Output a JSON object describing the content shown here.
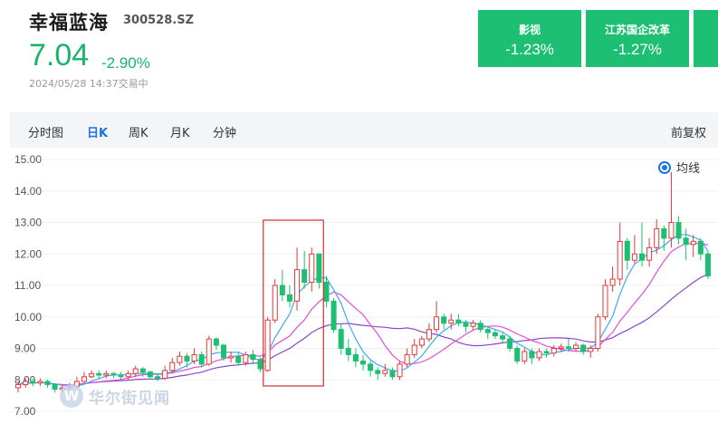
{
  "header": {
    "name": "幸福蓝海",
    "code": "300528.SZ",
    "price": "7.04",
    "change": "-2.90%",
    "timestamp": "2024/05/28 14:37交易中"
  },
  "sectors": [
    {
      "name": "影视",
      "change": "-1.23%"
    },
    {
      "name": "江苏国企改革",
      "change": "-1.27%"
    }
  ],
  "tabs": [
    "分时图",
    "日K",
    "周K",
    "月K",
    "分钟"
  ],
  "active_tab": "日K",
  "adjust_label": "前复权",
  "legend_label": "均线",
  "watermark": {
    "logo": "W",
    "text": "华尔街见闻"
  },
  "colors": {
    "up": "#e03a3a",
    "down": "#1dbf73",
    "ma5": "#3fa9f5",
    "ma10": "#e24fd3",
    "ma20": "#8d45c8",
    "highlight": "#d32f2f",
    "accent": "#1a73e8"
  },
  "chart_data": {
    "type": "candlestick",
    "ylim": [
      7.0,
      15.0
    ],
    "yticks": [
      "15.00",
      "14.00",
      "13.00",
      "12.00",
      "11.00",
      "10.00",
      "9.00",
      "8.00",
      "7.00"
    ],
    "grid": true,
    "candles": [
      [
        7.75,
        7.85,
        7.95,
        7.6
      ],
      [
        7.85,
        7.95,
        8.05,
        7.75
      ],
      [
        7.95,
        7.9,
        8.05,
        7.8
      ],
      [
        7.9,
        7.95,
        8.05,
        7.8
      ],
      [
        7.95,
        7.85,
        8.0,
        7.75
      ],
      [
        7.85,
        7.7,
        7.9,
        7.6
      ],
      [
        7.7,
        7.75,
        7.85,
        7.6
      ],
      [
        7.75,
        7.8,
        7.9,
        7.65
      ],
      [
        7.8,
        7.95,
        8.1,
        7.75
      ],
      [
        7.95,
        8.1,
        8.25,
        7.9
      ],
      [
        8.1,
        8.2,
        8.3,
        8.05
      ],
      [
        8.2,
        8.15,
        8.3,
        8.05
      ],
      [
        8.15,
        8.2,
        8.3,
        8.05
      ],
      [
        8.2,
        8.15,
        8.25,
        8.05
      ],
      [
        8.15,
        8.1,
        8.25,
        8.0
      ],
      [
        8.1,
        8.2,
        8.3,
        8.0
      ],
      [
        8.2,
        8.35,
        8.45,
        8.1
      ],
      [
        8.35,
        8.25,
        8.4,
        8.1
      ],
      [
        8.25,
        8.1,
        8.3,
        8.0
      ],
      [
        8.1,
        8.05,
        8.2,
        7.95
      ],
      [
        8.05,
        8.3,
        8.45,
        8.0
      ],
      [
        8.3,
        8.55,
        8.7,
        8.2
      ],
      [
        8.55,
        8.75,
        8.9,
        8.45
      ],
      [
        8.75,
        8.6,
        8.85,
        8.4
      ],
      [
        8.6,
        8.8,
        9.0,
        8.5
      ],
      [
        8.8,
        8.5,
        8.9,
        8.4
      ],
      [
        8.5,
        9.3,
        9.4,
        8.45
      ],
      [
        9.3,
        9.1,
        9.35,
        8.95
      ],
      [
        9.1,
        8.7,
        9.15,
        8.6
      ],
      [
        8.7,
        8.75,
        8.9,
        8.55
      ],
      [
        8.75,
        8.55,
        8.9,
        8.45
      ],
      [
        8.55,
        8.8,
        8.9,
        8.45
      ],
      [
        8.8,
        8.65,
        8.95,
        8.5
      ],
      [
        8.65,
        8.35,
        8.7,
        8.25
      ],
      [
        8.3,
        9.9,
        10.0,
        8.25
      ],
      [
        9.9,
        11.0,
        11.2,
        9.8
      ],
      [
        11.0,
        10.7,
        11.5,
        10.5
      ],
      [
        10.7,
        10.5,
        11.0,
        10.3
      ],
      [
        10.5,
        11.5,
        12.2,
        10.2
      ],
      [
        11.5,
        11.1,
        12.1,
        10.9
      ],
      [
        11.1,
        12.0,
        12.2,
        10.8
      ],
      [
        12.0,
        11.1,
        12.0,
        10.9
      ],
      [
        11.1,
        10.5,
        11.3,
        10.3
      ],
      [
        10.5,
        9.6,
        10.6,
        9.5
      ],
      [
        9.6,
        9.0,
        9.8,
        8.8
      ],
      [
        9.0,
        8.8,
        9.3,
        8.6
      ],
      [
        8.8,
        8.6,
        9.0,
        8.4
      ],
      [
        8.6,
        8.5,
        8.8,
        8.3
      ],
      [
        8.5,
        8.3,
        8.6,
        8.1
      ],
      [
        8.3,
        8.2,
        8.4,
        8.0
      ],
      [
        8.2,
        8.3,
        8.5,
        8.1
      ],
      [
        8.3,
        8.1,
        8.4,
        8.0
      ],
      [
        8.1,
        8.5,
        8.6,
        8.0
      ],
      [
        8.5,
        8.8,
        9.0,
        8.4
      ],
      [
        8.8,
        9.1,
        9.3,
        8.7
      ],
      [
        9.1,
        9.3,
        9.4,
        9.0
      ],
      [
        9.3,
        9.6,
        9.8,
        9.2
      ],
      [
        9.6,
        10.0,
        10.5,
        9.5
      ],
      [
        10.0,
        9.8,
        10.1,
        9.6
      ],
      [
        9.8,
        9.9,
        10.1,
        9.6
      ],
      [
        9.9,
        9.8,
        10.1,
        9.7
      ],
      [
        9.8,
        9.7,
        9.9,
        9.5
      ],
      [
        9.7,
        9.8,
        9.9,
        9.6
      ],
      [
        9.8,
        9.6,
        9.9,
        9.5
      ],
      [
        9.6,
        9.5,
        9.7,
        9.3
      ],
      [
        9.5,
        9.4,
        9.6,
        9.3
      ],
      [
        9.4,
        9.3,
        9.5,
        9.2
      ],
      [
        9.3,
        9.0,
        9.4,
        8.9
      ],
      [
        9.0,
        8.6,
        9.1,
        8.5
      ],
      [
        8.6,
        8.9,
        9.0,
        8.5
      ],
      [
        8.9,
        8.7,
        9.0,
        8.5
      ],
      [
        8.7,
        8.9,
        9.0,
        8.6
      ],
      [
        8.9,
        8.85,
        9.0,
        8.7
      ],
      [
        8.85,
        9.0,
        9.1,
        8.75
      ],
      [
        9.0,
        9.05,
        9.15,
        8.9
      ],
      [
        9.05,
        9.0,
        9.3,
        8.9
      ],
      [
        9.0,
        9.1,
        9.2,
        8.9
      ],
      [
        9.1,
        8.9,
        9.15,
        8.8
      ],
      [
        8.9,
        9.0,
        9.1,
        8.7
      ],
      [
        9.0,
        10.0,
        10.1,
        8.9
      ],
      [
        10.0,
        11.0,
        11.2,
        9.9
      ],
      [
        11.0,
        11.2,
        11.6,
        10.8
      ],
      [
        11.2,
        12.4,
        13.0,
        11.0
      ],
      [
        12.4,
        11.8,
        12.5,
        11.5
      ],
      [
        11.8,
        12.0,
        12.6,
        11.7
      ],
      [
        12.0,
        11.8,
        13.0,
        11.6
      ],
      [
        11.8,
        12.2,
        12.5,
        11.6
      ],
      [
        12.2,
        12.8,
        13.1,
        12.0
      ],
      [
        12.8,
        12.5,
        12.9,
        12.1
      ],
      [
        12.5,
        13.0,
        14.6,
        12.2
      ],
      [
        13.0,
        12.5,
        13.2,
        12.3
      ],
      [
        12.5,
        12.3,
        12.8,
        11.8
      ],
      [
        12.3,
        12.4,
        12.6,
        11.9
      ],
      [
        12.4,
        12.0,
        12.5,
        11.8
      ],
      [
        12.0,
        11.3,
        12.1,
        11.2
      ]
    ]
  }
}
